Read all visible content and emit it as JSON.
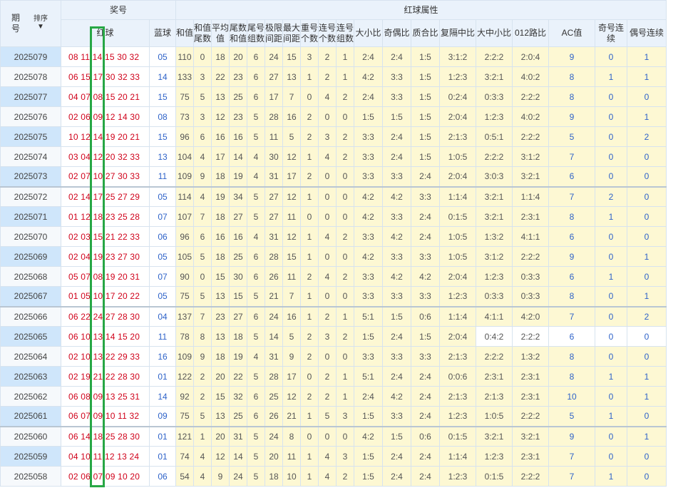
{
  "header": {
    "issue": "期号",
    "sort": "排序",
    "sort_arrow": "▼",
    "prize": "奖号",
    "red_ball": "红球",
    "blue_ball": "蓝球",
    "red_attr": "红球属性",
    "cols": [
      "和值",
      "和值尾数",
      "平均值",
      "尾数和值",
      "尾号组数",
      "极限间距",
      "最大间距",
      "重号个数",
      "连号个数",
      "连号组数",
      "大小比",
      "奇偶比",
      "质合比",
      "复隔中比",
      "大中小比",
      "012路比",
      "AC值",
      "奇号连续",
      "偶号连续"
    ]
  },
  "rows": [
    {
      "issue": "2025079",
      "red": "08 11 14 15 30 32",
      "blue": "05",
      "v": [
        "110",
        "0",
        "18",
        "20",
        "6",
        "24",
        "15",
        "3",
        "2",
        "1",
        "2:4",
        "2:4",
        "1:5",
        "3:1:2",
        "2:2:2",
        "2:0:4",
        "9",
        "0",
        "1"
      ]
    },
    {
      "issue": "2025078",
      "red": "06 15 17 30 32 33",
      "blue": "14",
      "v": [
        "133",
        "3",
        "22",
        "23",
        "6",
        "27",
        "13",
        "1",
        "2",
        "1",
        "4:2",
        "3:3",
        "1:5",
        "1:2:3",
        "3:2:1",
        "4:0:2",
        "8",
        "1",
        "1"
      ]
    },
    {
      "issue": "2025077",
      "red": "04 07 08 15 20 21",
      "blue": "15",
      "v": [
        "75",
        "5",
        "13",
        "25",
        "6",
        "17",
        "7",
        "0",
        "4",
        "2",
        "2:4",
        "3:3",
        "1:5",
        "0:2:4",
        "0:3:3",
        "2:2:2",
        "8",
        "0",
        "0"
      ]
    },
    {
      "issue": "2025076",
      "red": "02 06 09 12 14 30",
      "blue": "08",
      "v": [
        "73",
        "3",
        "12",
        "23",
        "5",
        "28",
        "16",
        "2",
        "0",
        "0",
        "1:5",
        "1:5",
        "1:5",
        "2:0:4",
        "1:2:3",
        "4:0:2",
        "9",
        "0",
        "1"
      ]
    },
    {
      "issue": "2025075",
      "red": "10 12 14 19 20 21",
      "blue": "15",
      "v": [
        "96",
        "6",
        "16",
        "16",
        "5",
        "11",
        "5",
        "2",
        "3",
        "2",
        "3:3",
        "2:4",
        "1:5",
        "2:1:3",
        "0:5:1",
        "2:2:2",
        "5",
        "0",
        "2"
      ]
    },
    {
      "issue": "2025074",
      "red": "03 04 12 20 32 33",
      "blue": "13",
      "v": [
        "104",
        "4",
        "17",
        "14",
        "4",
        "30",
        "12",
        "1",
        "4",
        "2",
        "3:3",
        "2:4",
        "1:5",
        "1:0:5",
        "2:2:2",
        "3:1:2",
        "7",
        "0",
        "0"
      ]
    },
    {
      "issue": "2025073",
      "red": "02 07 10 27 30 33",
      "blue": "11",
      "v": [
        "109",
        "9",
        "18",
        "19",
        "4",
        "31",
        "17",
        "2",
        "0",
        "0",
        "3:3",
        "3:3",
        "2:4",
        "2:0:4",
        "3:0:3",
        "3:2:1",
        "6",
        "0",
        "0"
      ]
    },
    {
      "issue": "2025072",
      "red": "02 14 17 25 27 29",
      "blue": "05",
      "v": [
        "114",
        "4",
        "19",
        "34",
        "5",
        "27",
        "12",
        "1",
        "0",
        "0",
        "4:2",
        "4:2",
        "3:3",
        "1:1:4",
        "3:2:1",
        "1:1:4",
        "7",
        "2",
        "0"
      ]
    },
    {
      "issue": "2025071",
      "red": "01 12 18 23 25 28",
      "blue": "07",
      "v": [
        "107",
        "7",
        "18",
        "27",
        "5",
        "27",
        "11",
        "0",
        "0",
        "0",
        "4:2",
        "3:3",
        "2:4",
        "0:1:5",
        "3:2:1",
        "2:3:1",
        "8",
        "1",
        "0"
      ]
    },
    {
      "issue": "2025070",
      "red": "02 03 15 21 22 33",
      "blue": "06",
      "v": [
        "96",
        "6",
        "16",
        "16",
        "4",
        "31",
        "12",
        "1",
        "4",
        "2",
        "3:3",
        "4:2",
        "2:4",
        "1:0:5",
        "1:3:2",
        "4:1:1",
        "6",
        "0",
        "0"
      ]
    },
    {
      "issue": "2025069",
      "red": "02 04 19 23 27 30",
      "blue": "05",
      "v": [
        "105",
        "5",
        "18",
        "25",
        "6",
        "28",
        "15",
        "1",
        "0",
        "0",
        "4:2",
        "3:3",
        "3:3",
        "1:0:5",
        "3:1:2",
        "2:2:2",
        "9",
        "0",
        "1"
      ]
    },
    {
      "issue": "2025068",
      "red": "05 07 08 19 20 31",
      "blue": "07",
      "v": [
        "90",
        "0",
        "15",
        "30",
        "6",
        "26",
        "11",
        "2",
        "4",
        "2",
        "3:3",
        "4:2",
        "4:2",
        "2:0:4",
        "1:2:3",
        "0:3:3",
        "6",
        "1",
        "0"
      ]
    },
    {
      "issue": "2025067",
      "red": "01 05 10 17 20 22",
      "blue": "05",
      "v": [
        "75",
        "5",
        "13",
        "15",
        "5",
        "21",
        "7",
        "1",
        "0",
        "0",
        "3:3",
        "3:3",
        "3:3",
        "1:2:3",
        "0:3:3",
        "0:3:3",
        "8",
        "0",
        "1"
      ]
    },
    {
      "issue": "2025066",
      "red": "06 22 24 27 28 30",
      "blue": "04",
      "v": [
        "137",
        "7",
        "23",
        "27",
        "6",
        "24",
        "16",
        "1",
        "2",
        "1",
        "5:1",
        "1:5",
        "0:6",
        "1:1:4",
        "4:1:1",
        "4:2:0",
        "7",
        "0",
        "2"
      ]
    },
    {
      "issue": "2025065",
      "red": "06 10 13 14 15 20",
      "blue": "11",
      "v": [
        "78",
        "8",
        "13",
        "18",
        "5",
        "14",
        "5",
        "2",
        "3",
        "2",
        "1:5",
        "2:4",
        "1:5",
        "2:0:4",
        "0:4:2",
        "2:2:2",
        "6",
        "0",
        "0"
      ]
    },
    {
      "issue": "2025064",
      "red": "02 10 13 22 29 33",
      "blue": "16",
      "v": [
        "109",
        "9",
        "18",
        "19",
        "4",
        "31",
        "9",
        "2",
        "0",
        "0",
        "3:3",
        "3:3",
        "3:3",
        "2:1:3",
        "2:2:2",
        "1:3:2",
        "8",
        "0",
        "0"
      ]
    },
    {
      "issue": "2025063",
      "red": "02 19 21 22 28 30",
      "blue": "01",
      "v": [
        "122",
        "2",
        "20",
        "22",
        "5",
        "28",
        "17",
        "0",
        "2",
        "1",
        "5:1",
        "2:4",
        "2:4",
        "0:0:6",
        "2:3:1",
        "2:3:1",
        "8",
        "1",
        "1"
      ]
    },
    {
      "issue": "2025062",
      "red": "06 08 09 13 25 31",
      "blue": "14",
      "v": [
        "92",
        "2",
        "15",
        "32",
        "6",
        "25",
        "12",
        "2",
        "2",
        "1",
        "2:4",
        "4:2",
        "2:4",
        "2:1:3",
        "2:1:3",
        "2:3:1",
        "10",
        "0",
        "1"
      ]
    },
    {
      "issue": "2025061",
      "red": "06 07 09 10 11 32",
      "blue": "09",
      "v": [
        "75",
        "5",
        "13",
        "25",
        "6",
        "26",
        "21",
        "1",
        "5",
        "3",
        "1:5",
        "3:3",
        "2:4",
        "1:2:3",
        "1:0:5",
        "2:2:2",
        "5",
        "1",
        "0"
      ]
    },
    {
      "issue": "2025060",
      "red": "06 14 18 25 28 30",
      "blue": "01",
      "v": [
        "121",
        "1",
        "20",
        "31",
        "5",
        "24",
        "8",
        "0",
        "0",
        "0",
        "4:2",
        "1:5",
        "0:6",
        "0:1:5",
        "3:2:1",
        "3:2:1",
        "9",
        "0",
        "1"
      ]
    },
    {
      "issue": "2025059",
      "red": "04 10 11 12 13 24",
      "blue": "01",
      "v": [
        "74",
        "4",
        "12",
        "14",
        "5",
        "20",
        "11",
        "1",
        "4",
        "3",
        "1:5",
        "2:4",
        "2:4",
        "1:1:4",
        "1:2:3",
        "2:3:1",
        "7",
        "0",
        "0"
      ]
    },
    {
      "issue": "2025058",
      "red": "02 06 07 09 10 20",
      "blue": "06",
      "v": [
        "54",
        "4",
        "9",
        "24",
        "5",
        "18",
        "10",
        "1",
        "4",
        "2",
        "1:5",
        "2:4",
        "2:4",
        "1:2:3",
        "0:1:5",
        "2:2:2",
        "7",
        "1",
        "0"
      ]
    }
  ]
}
